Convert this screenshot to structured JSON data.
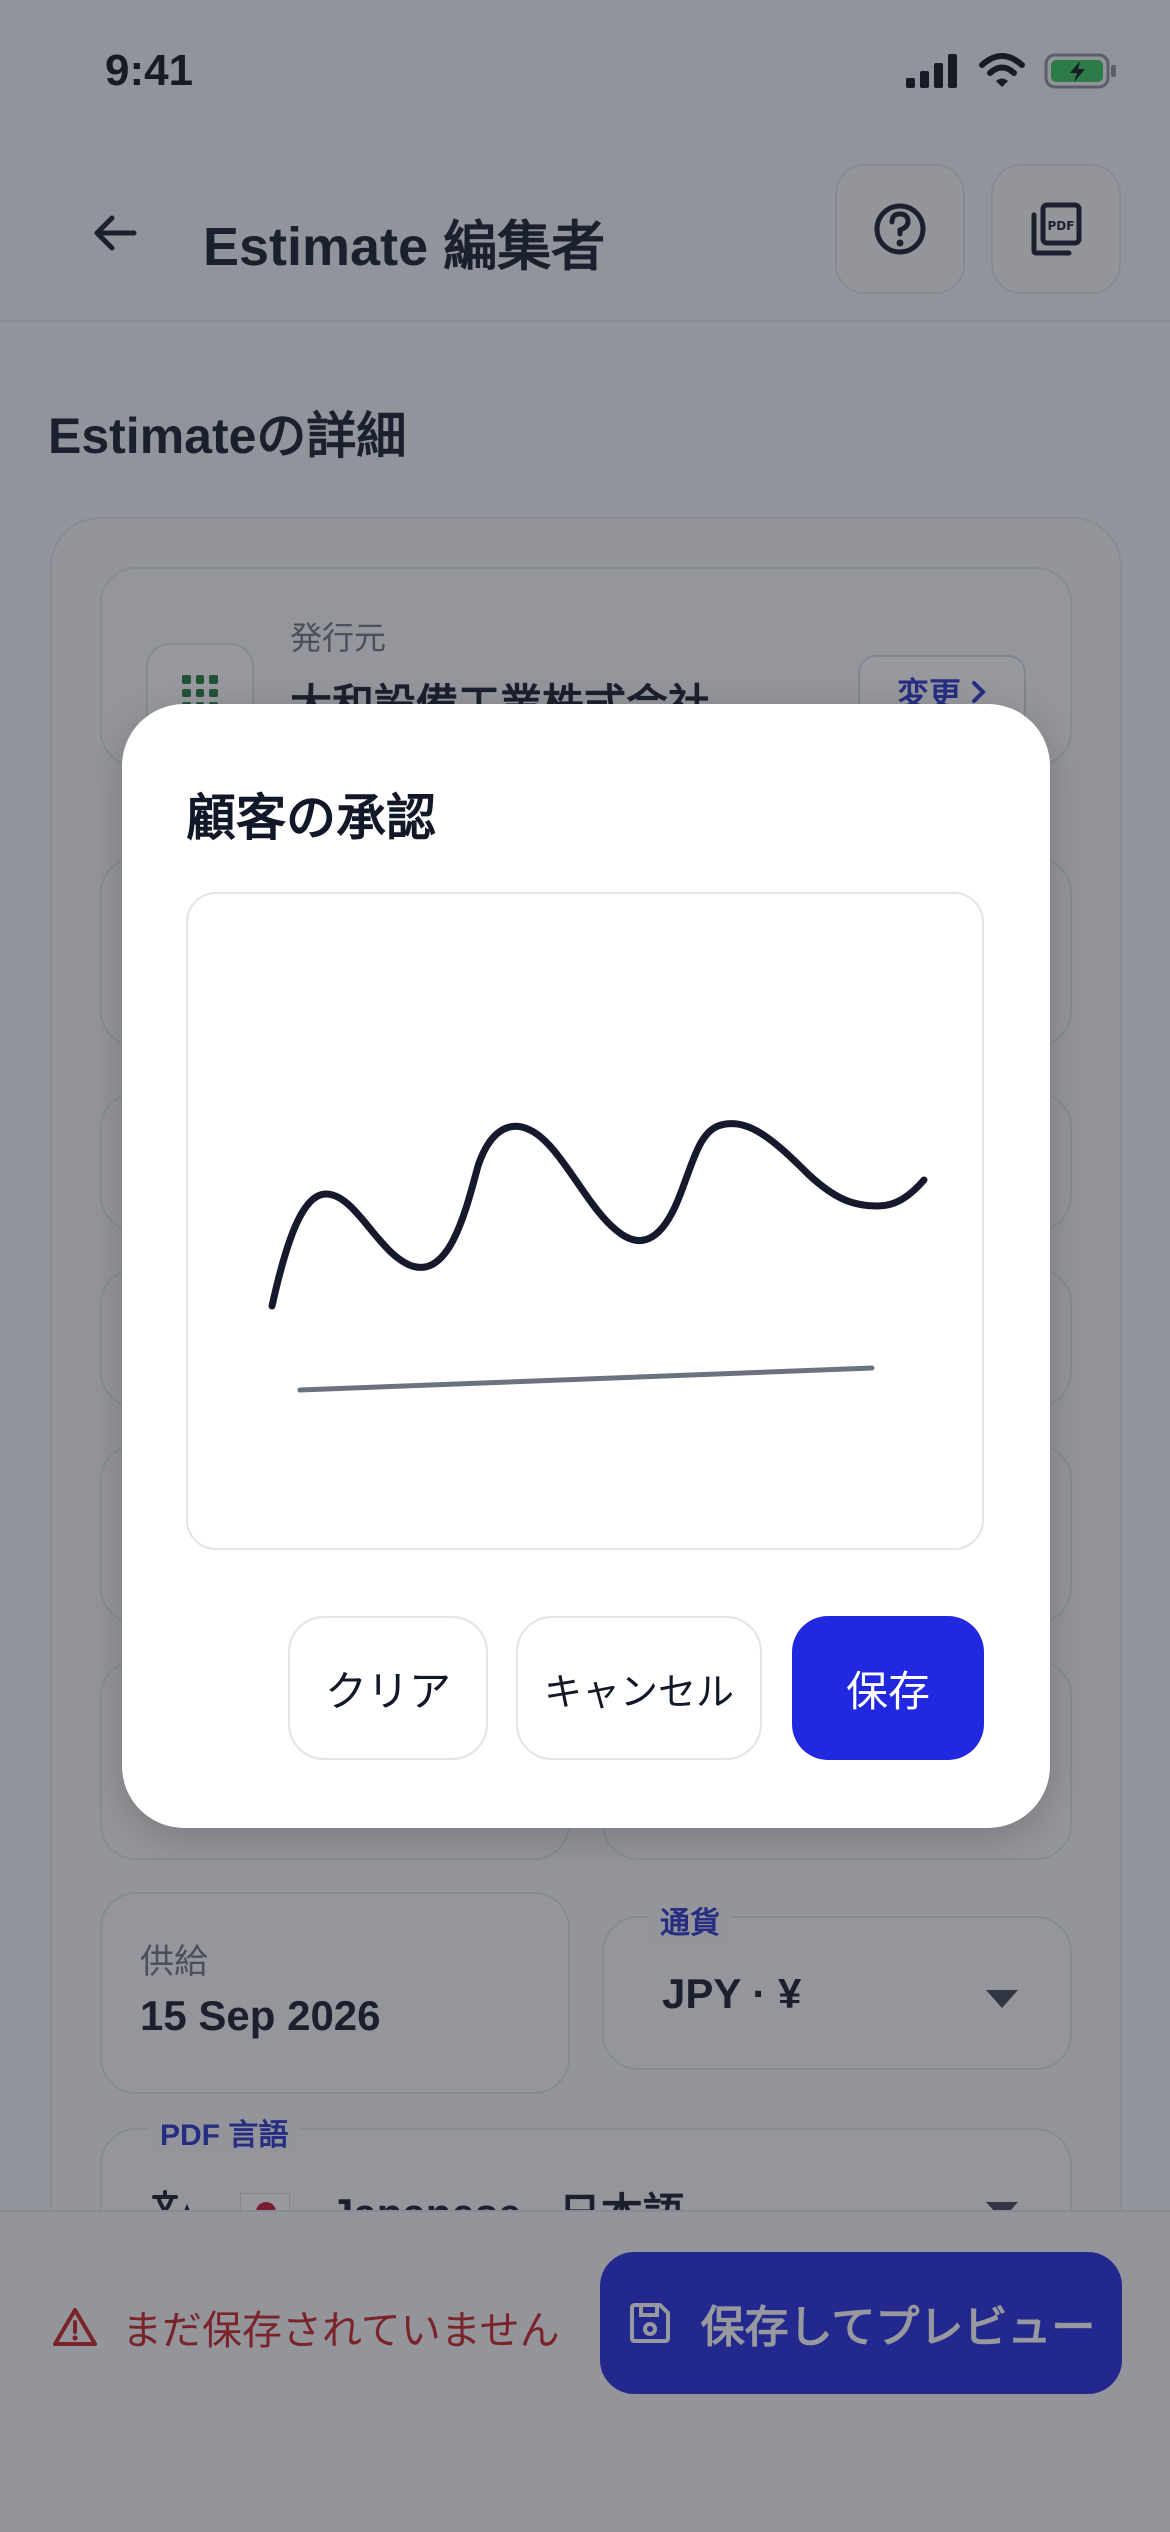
{
  "status_bar": {
    "time": "9:41"
  },
  "header": {
    "title": "Estimate 編集者",
    "help_icon": "help-circle-icon",
    "pdf_icon": "pdf-icon"
  },
  "main": {
    "section_title": "Estimateの詳細",
    "issuer": {
      "label": "発行元",
      "name": "大和設備工業株式会社",
      "change_label": "変更"
    },
    "supply": {
      "label": "供給",
      "value": "15 Sep 2026"
    },
    "currency": {
      "label": "通貨",
      "value": "JPY · ¥"
    },
    "pdf_language": {
      "label": "PDF 言語",
      "value": "Japanese · 日本語"
    }
  },
  "bottom_bar": {
    "unsaved_text": "まだ保存されていません",
    "save_preview_label": "保存してプレビュー"
  },
  "modal": {
    "title": "顧客の承認",
    "clear_label": "クリア",
    "cancel_label": "キャンセル",
    "save_label": "保存"
  },
  "colors": {
    "accent": "#2128e0",
    "error": "#c81e1e",
    "text": "#111827",
    "battery": "#34c759"
  }
}
